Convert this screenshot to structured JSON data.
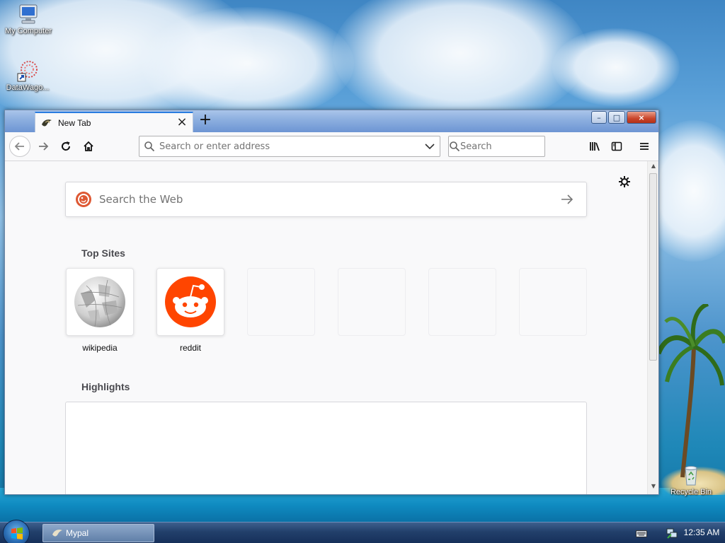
{
  "desktop": {
    "icons": [
      {
        "label": "My Computer",
        "icon": "computer-icon"
      },
      {
        "label": "DataWago...",
        "icon": "datawagon-shortcut-icon"
      },
      {
        "label": "Recycle Bin",
        "icon": "recycle-bin-icon"
      }
    ]
  },
  "browser": {
    "tab": {
      "title": "New Tab",
      "close_glyph": "×"
    },
    "new_tab_glyph": "+",
    "window_controls": {
      "minimize": "–",
      "maximize": "□",
      "close": "×"
    },
    "toolbar": {
      "address_placeholder": "Search or enter address",
      "search_placeholder": "Search"
    },
    "newtab_page": {
      "web_search_placeholder": "Search the Web",
      "top_sites_title": "Top Sites",
      "top_sites": [
        {
          "label": "wikipedia"
        },
        {
          "label": "reddit"
        }
      ],
      "highlights_title": "Highlights"
    }
  },
  "taskbar": {
    "window_button_label": "Mypal",
    "clock": "12:35 AM"
  },
  "colors": {
    "accent_tab": "#2a7ce0",
    "reddit": "#ff4500",
    "duckduckgo": "#de5833"
  }
}
